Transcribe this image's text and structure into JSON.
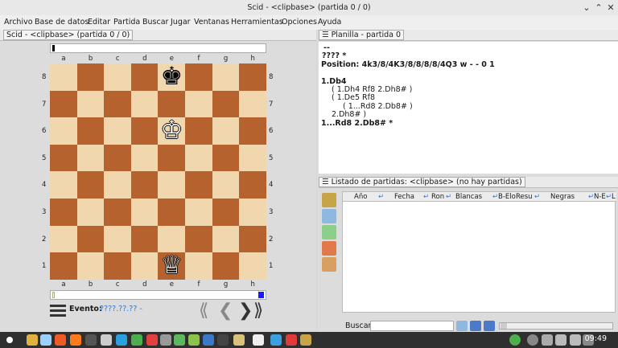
{
  "window": {
    "title": "Scid - <clipbase> (partida 0 / 0)"
  },
  "menu": [
    "Archivo",
    "Base de datos",
    "Editar",
    "Partida",
    "Buscar",
    "Jugar",
    "Ventanas",
    "Herramientas",
    "Opciones",
    "Ayuda"
  ],
  "left_pane": {
    "header": "Scid - <clipbase> (partida 0 / 0)"
  },
  "board": {
    "files": [
      "a",
      "b",
      "c",
      "d",
      "e",
      "f",
      "g",
      "h"
    ],
    "ranks": [
      "8",
      "7",
      "6",
      "5",
      "4",
      "3",
      "2",
      "1"
    ],
    "pieces": [
      {
        "square": "e8",
        "glyph": "♚",
        "name": "black-king"
      },
      {
        "square": "e6",
        "glyph": "♔",
        "name": "white-king"
      },
      {
        "square": "e1",
        "glyph": "♕",
        "name": "white-queen"
      }
    ]
  },
  "game_info": {
    "label": "Evento:",
    "value": "????.??.?? -"
  },
  "nav": {
    "first": "⟪",
    "prev": "❮",
    "next": "❯",
    "last": "⟫"
  },
  "pgn": {
    "header": "Planilla - partida 0",
    "lines": [
      {
        "text": "--",
        "bold": true
      },
      {
        "text": "????  *",
        "bold": true
      },
      {
        "text": "Position: 4k3/8/4K3/8/8/8/8/4Q3 w - - 0 1",
        "bold": true
      },
      {
        "text": "",
        "bold": false
      },
      {
        "text": "1.Db4",
        "bold": true
      },
      {
        "text": "( 1.Dh4 Rf8 2.Dh8# )",
        "bold": false
      },
      {
        "text": "( 1.De5 Rf8",
        "bold": false
      },
      {
        "text": "( 1...Rd8 2.Db8# )",
        "bold": false
      },
      {
        "text": "2.Dh8# )",
        "bold": false
      },
      {
        "text": "1...Rd8 2.Db8# *",
        "bold": true
      }
    ]
  },
  "game_list": {
    "header": "Listado de partidas: <clipbase> (no hay partidas)",
    "columns": [
      "Año",
      "Fecha",
      "Ron",
      "Blancas",
      "B-Elo",
      "Resu",
      "Negras",
      "N-E",
      "L"
    ],
    "search_label": "Buscar",
    "search_value": ""
  },
  "taskbar": {
    "time": "09:49"
  }
}
